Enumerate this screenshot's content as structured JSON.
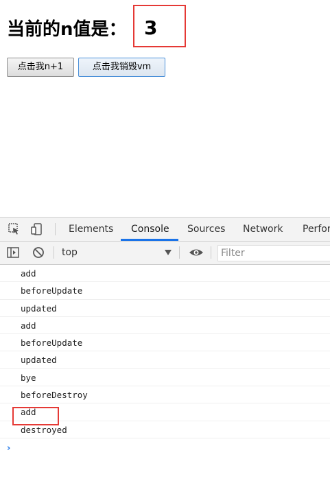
{
  "page": {
    "heading_label": "当前的n值是：",
    "n_value": "3",
    "buttons": {
      "add_label": "点击我n+1",
      "destroy_label": "点击我销毁vm"
    }
  },
  "devtools": {
    "tabs": [
      "Elements",
      "Console",
      "Sources",
      "Network",
      "Perfor"
    ],
    "active_tab": "Console",
    "context": "top",
    "filter_placeholder": "Filter",
    "console_logs": [
      "add",
      "beforeUpdate",
      "updated",
      "add",
      "beforeUpdate",
      "updated",
      "bye",
      "beforeDestroy",
      "add",
      "destroyed"
    ],
    "prompt_symbol": "›"
  },
  "colors": {
    "highlight_box": "#e53935",
    "active_tab_underline": "#1a73e8",
    "prompt": "#1a73e8"
  }
}
